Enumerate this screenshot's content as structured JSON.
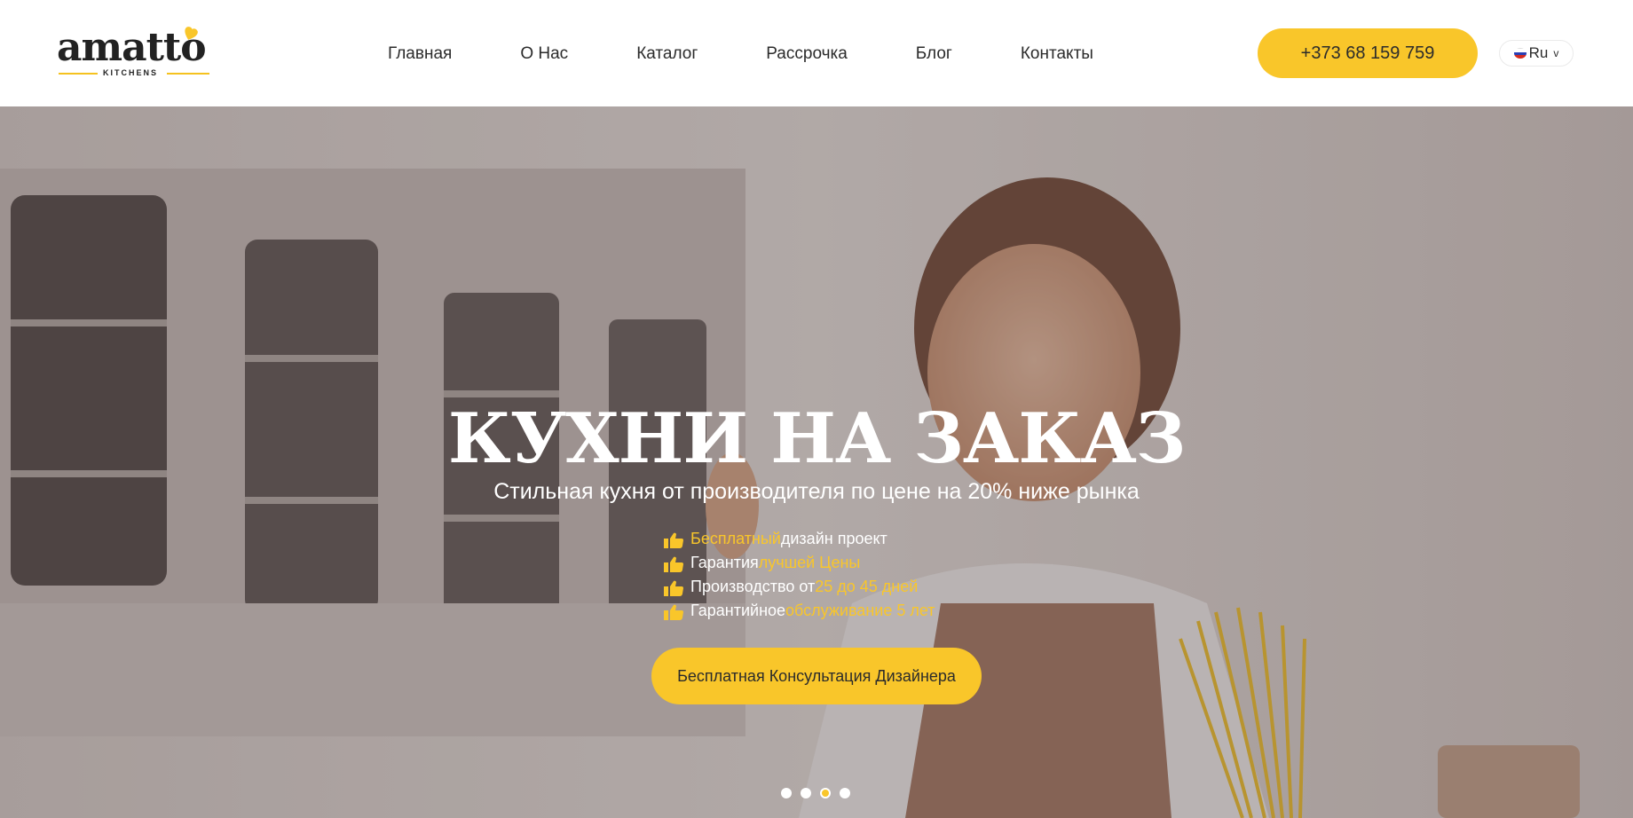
{
  "brand": {
    "name": "amatto",
    "subtitle": "KITCHENS",
    "accent_color": "#f9c62a"
  },
  "nav": {
    "items": [
      {
        "label": "Главная"
      },
      {
        "label": "О Нас"
      },
      {
        "label": "Каталог"
      },
      {
        "label": "Рассрочка"
      },
      {
        "label": "Блог"
      },
      {
        "label": "Контакты"
      }
    ]
  },
  "header": {
    "phone": "+373 68 159 759",
    "language": "Ru",
    "language_icon": "russia-flag-icon",
    "chevron_icon": "chevron-down-icon"
  },
  "hero": {
    "title": "КУХНИ НА ЗАКАЗ",
    "subtitle": "Стильная кухня от производителя по цене на 20% ниже рынка",
    "features": [
      {
        "icon": "thumbs-up-icon",
        "highlight": "Бесплатный",
        "text": " дизайн проект",
        "highlight_first": true
      },
      {
        "icon": "thumbs-up-icon",
        "text": "Гарантия ",
        "highlight": "лучшей Цены",
        "highlight_first": false
      },
      {
        "icon": "thumbs-up-icon",
        "text": "Производство от ",
        "highlight": "25 до 45 дней",
        "highlight_first": false
      },
      {
        "icon": "thumbs-up-icon",
        "text": "Гарантийное ",
        "highlight": "обслуживание 5 лет",
        "highlight_first": false
      }
    ],
    "cta_label": "Бесплатная Консультация Дизайнера",
    "slides": 4,
    "active_slide": 3
  }
}
